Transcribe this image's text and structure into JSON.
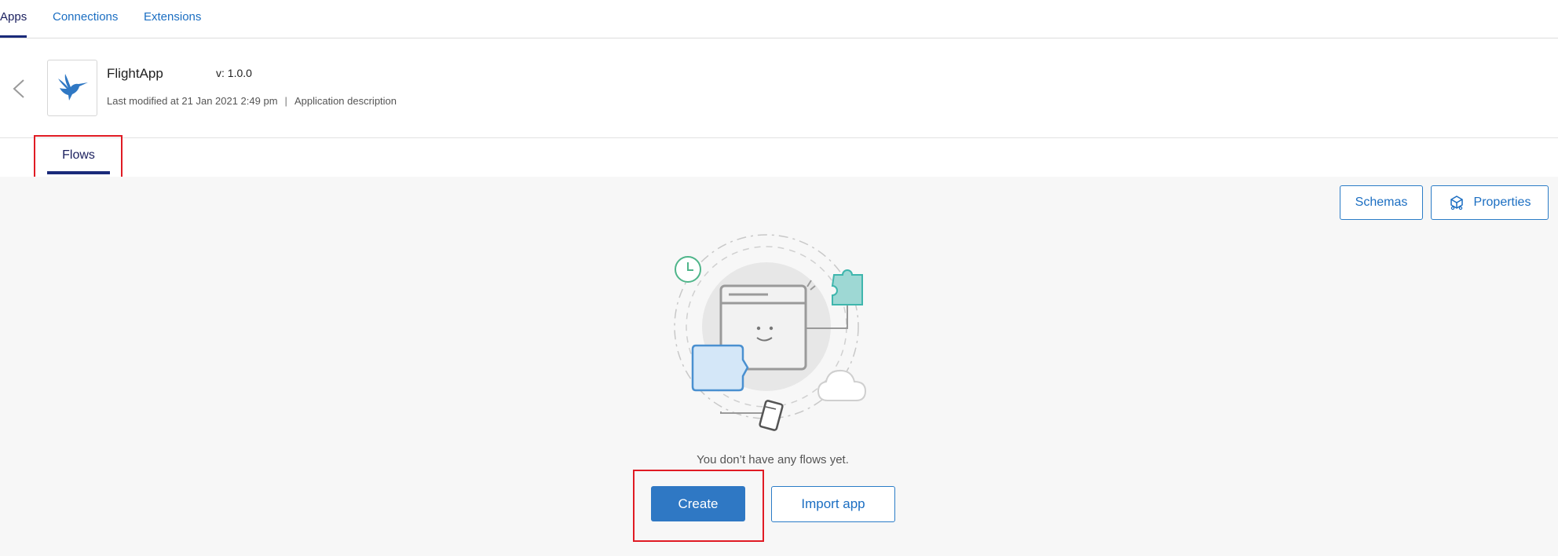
{
  "topnav": {
    "tabs": [
      {
        "label": "Apps",
        "active": true
      },
      {
        "label": "Connections",
        "active": false
      },
      {
        "label": "Extensions",
        "active": false
      }
    ]
  },
  "app": {
    "name": "FlightApp",
    "version": "v: 1.0.0",
    "last_modified": "Last modified at 21 Jan 2021 2:49 pm",
    "separator": "|",
    "description": "Application description",
    "logo_icon": "hummingbird-icon"
  },
  "subtabs": {
    "flows_label": "Flows"
  },
  "toolbar": {
    "schemas_label": "Schemas",
    "properties_label": "Properties",
    "properties_icon": "package-icon"
  },
  "empty_state": {
    "message": "You don’t have any flows yet.",
    "create_label": "Create",
    "import_label": "Import app"
  },
  "colors": {
    "accent": "#2f78c4",
    "nav_active": "#1a2a7a",
    "highlight": "#e01b24",
    "background": "#f7f7f7"
  }
}
